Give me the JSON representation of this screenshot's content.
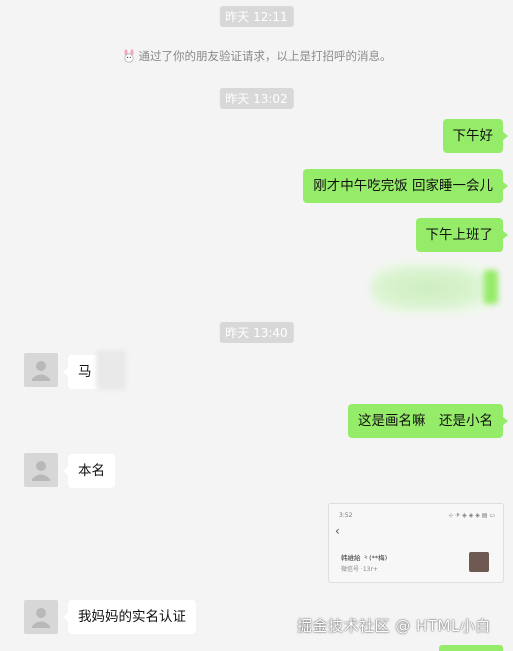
{
  "timestamps": [
    "昨天 12:11",
    "昨天 13:02",
    "昨天 13:40"
  ],
  "system_message": "通过了你的朋友验证请求，以上是打招呼的消息。",
  "messages": {
    "out_1": "下午好",
    "out_2": "刚才中午吃完饭 回家睡一会儿",
    "out_3": "下午上班了",
    "in_1": "马",
    "out_4": "这是画名嘛　还是小名",
    "in_2": "本名",
    "in_3": "我妈妈的实名认证"
  },
  "screenshot_preview": {
    "status_time": "3:52",
    "status_icons": "⊹ ✈ ◈ ◈ ◈ ▤ ▭",
    "back_icon": "chevron-left-icon",
    "name_line": "韩維給 ⺀(**梅)",
    "account_line": "微信号 ·13r+"
  },
  "watermark": "掘金技术社区 @ HTML小白",
  "icons": {
    "system_icon": "rabbit-icon",
    "avatar": "user-silhouette-icon"
  },
  "colors": {
    "outgoing_bubble": "#95ec69",
    "incoming_bubble": "#ffffff",
    "background": "#f4f4f4",
    "timestamp_bg": "#d8d8d8"
  }
}
